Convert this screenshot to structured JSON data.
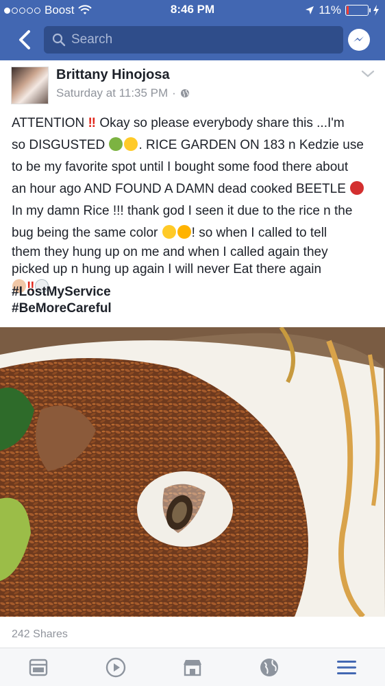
{
  "status_bar": {
    "carrier": "Boost",
    "time": "8:46 PM",
    "battery_percent": "11%",
    "battery_level": 0.11,
    "icons": [
      "signal-dots",
      "wifi-icon",
      "location-arrow-icon",
      "battery-icon",
      "charging-icon"
    ]
  },
  "nav": {
    "search_placeholder": "Search",
    "icons": [
      "back-chevron-icon",
      "search-icon",
      "messenger-icon"
    ]
  },
  "post": {
    "author": "Brittany Hinojosa",
    "timestamp": "Saturday at 11:35 PM",
    "separator": "·",
    "privacy_icon": "globe-icon",
    "text_lines": [
      "ATTENTION",
      "Okay so please everybody share this ...I'm",
      "so DISGUSTED",
      ". RICE GARDEN ON 183 n Kedzie use",
      "to be my favorite spot until I bought some food there about",
      "an hour ago AND FOUND A DAMN dead cooked BEETLE",
      "In my damn Rice !!! thank god I seen it due to the rice n the",
      "bug being the same color",
      "! so when I called to tell",
      "them they hung up on me and when I called again they",
      "picked up n hung up again  I will never Eat there again"
    ],
    "exclamation": "‼",
    "hashtags": [
      "#LostMyService",
      "#BeMoreCareful"
    ],
    "shares": "242 Shares",
    "photo_alt_icon": "photo-of-fried-rice-with-beetle"
  },
  "tabbar": {
    "items": [
      "news-feed-icon",
      "video-icon",
      "marketplace-icon",
      "notifications-globe-icon",
      "menu-icon"
    ],
    "active_index": 4
  },
  "colors": {
    "brand": "#4267b2",
    "search_bg": "#2f4d8a",
    "meta_text": "#90949c",
    "active_tab": "#4267b2",
    "inactive_tab": "#8d949e"
  }
}
